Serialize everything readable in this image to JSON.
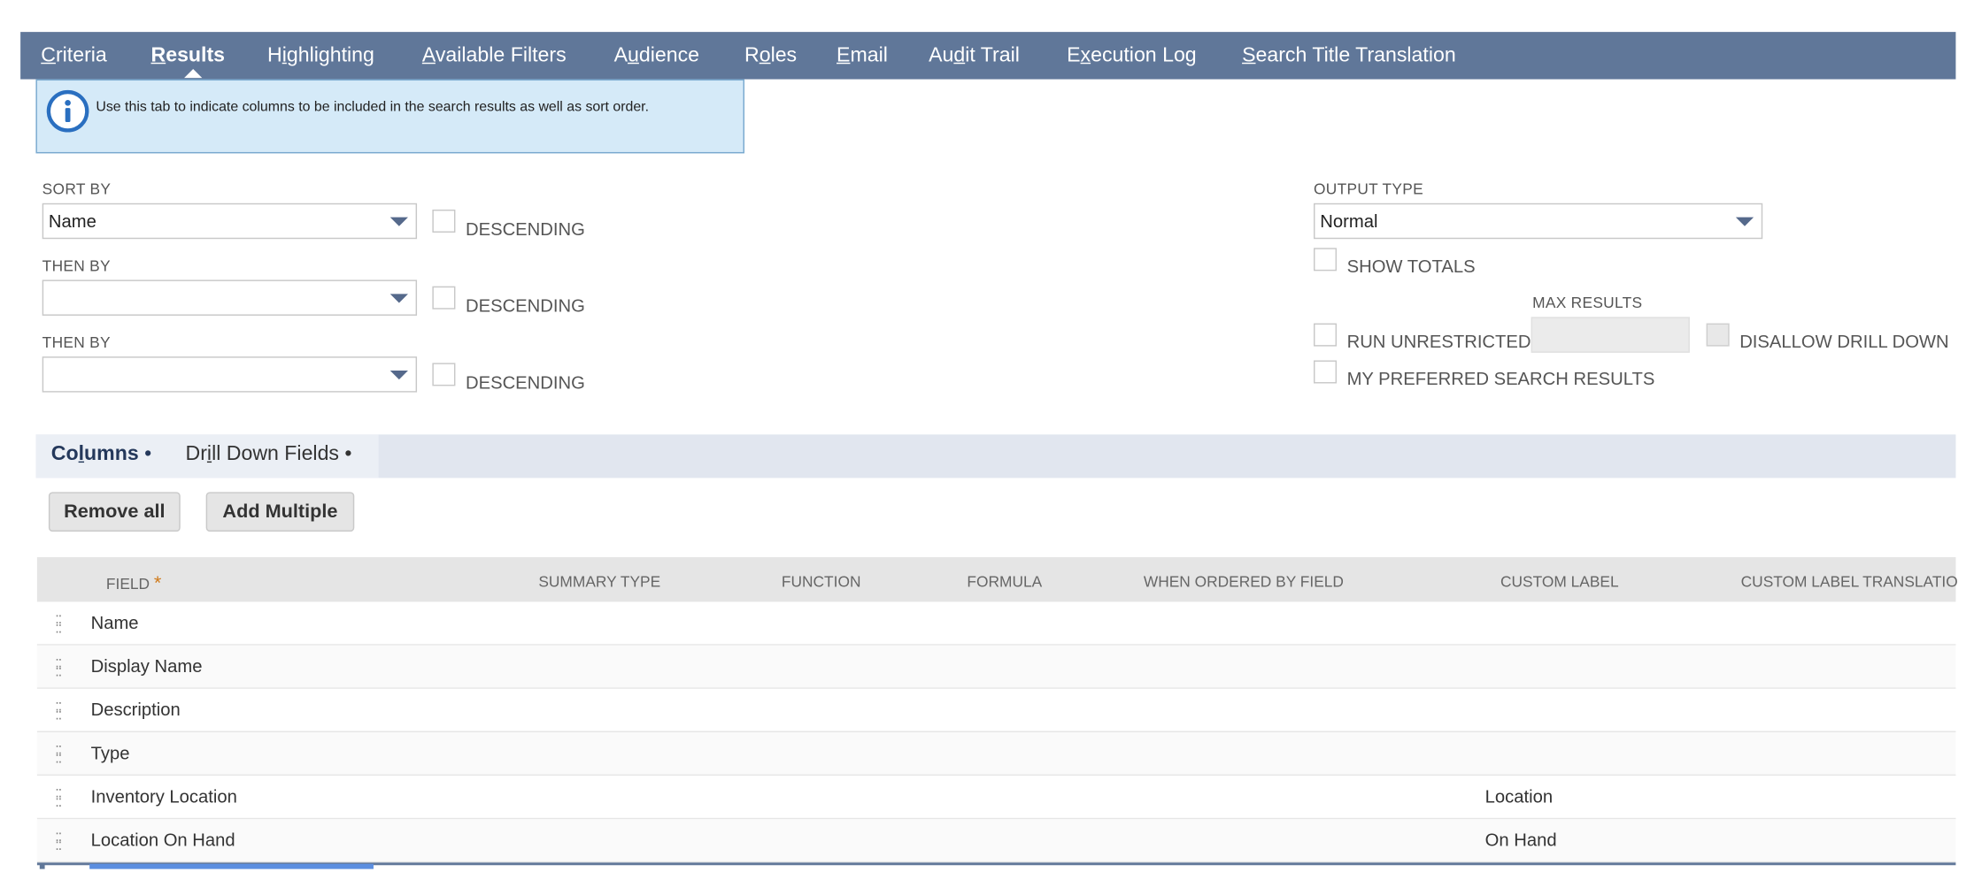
{
  "tabs": [
    {
      "pre": "",
      "u": "C",
      "post": "riteria"
    },
    {
      "pre": "",
      "u": "R",
      "post": "esults"
    },
    {
      "pre": "H",
      "u": "i",
      "post": "ghlighting"
    },
    {
      "pre": "",
      "u": "A",
      "post": "vailable Filters"
    },
    {
      "pre": "A",
      "u": "u",
      "post": "dience"
    },
    {
      "pre": "R",
      "u": "o",
      "post": "les"
    },
    {
      "pre": "",
      "u": "E",
      "post": "mail"
    },
    {
      "pre": "Au",
      "u": "d",
      "post": "it Trail"
    },
    {
      "pre": "E",
      "u": "x",
      "post": "ecution Log"
    },
    {
      "pre": "",
      "u": "S",
      "post": "earch Title Translation"
    }
  ],
  "info": {
    "text": "Use this tab to indicate columns to be included in the search results as well as sort order."
  },
  "sort": {
    "sort_by_label": "SORT BY",
    "sort_by_value": "Name",
    "then_by_label": "THEN BY",
    "then_by_1_value": "",
    "then_by_2_value": "",
    "descending_label": "DESCENDING"
  },
  "output": {
    "output_type_label": "OUTPUT TYPE",
    "output_type_value": "Normal",
    "show_totals_label": "SHOW TOTALS",
    "max_results_label": "MAX RESULTS",
    "max_results_value": "",
    "run_unrestricted_label": "RUN UNRESTRICTED",
    "disallow_drill_down_label": "DISALLOW DRILL DOWN",
    "my_preferred_label": "MY PREFERRED SEARCH RESULTS"
  },
  "subtabs": {
    "columns": {
      "pre": "Co",
      "u": "l",
      "post": "umns",
      "dot": " •"
    },
    "drill": {
      "pre": "Dr",
      "u": "i",
      "post": "ll Down Fields",
      "dot": " •"
    }
  },
  "buttons": {
    "remove_all": "Remove all",
    "add_multiple": "Add Multiple"
  },
  "table": {
    "headers": {
      "field": "FIELD",
      "required_mark": "*",
      "summary_type": "SUMMARY TYPE",
      "function": "FUNCTION",
      "formula": "FORMULA",
      "when_ordered": "WHEN ORDERED BY FIELD",
      "custom_label": "CUSTOM LABEL",
      "custom_label_translation": "CUSTOM LABEL TRANSLATIO"
    },
    "rows": [
      {
        "field": "Name",
        "custom_label": ""
      },
      {
        "field": "Display Name",
        "custom_label": ""
      },
      {
        "field": "Description",
        "custom_label": ""
      },
      {
        "field": "Type",
        "custom_label": ""
      },
      {
        "field": "Inventory Location",
        "custom_label": "Location"
      },
      {
        "field": "Location On Hand",
        "custom_label": "On Hand"
      }
    ]
  },
  "colors": {
    "tab_bar": "#607799",
    "info_bg": "#d5eaf8",
    "accent": "#5b8ee0"
  }
}
